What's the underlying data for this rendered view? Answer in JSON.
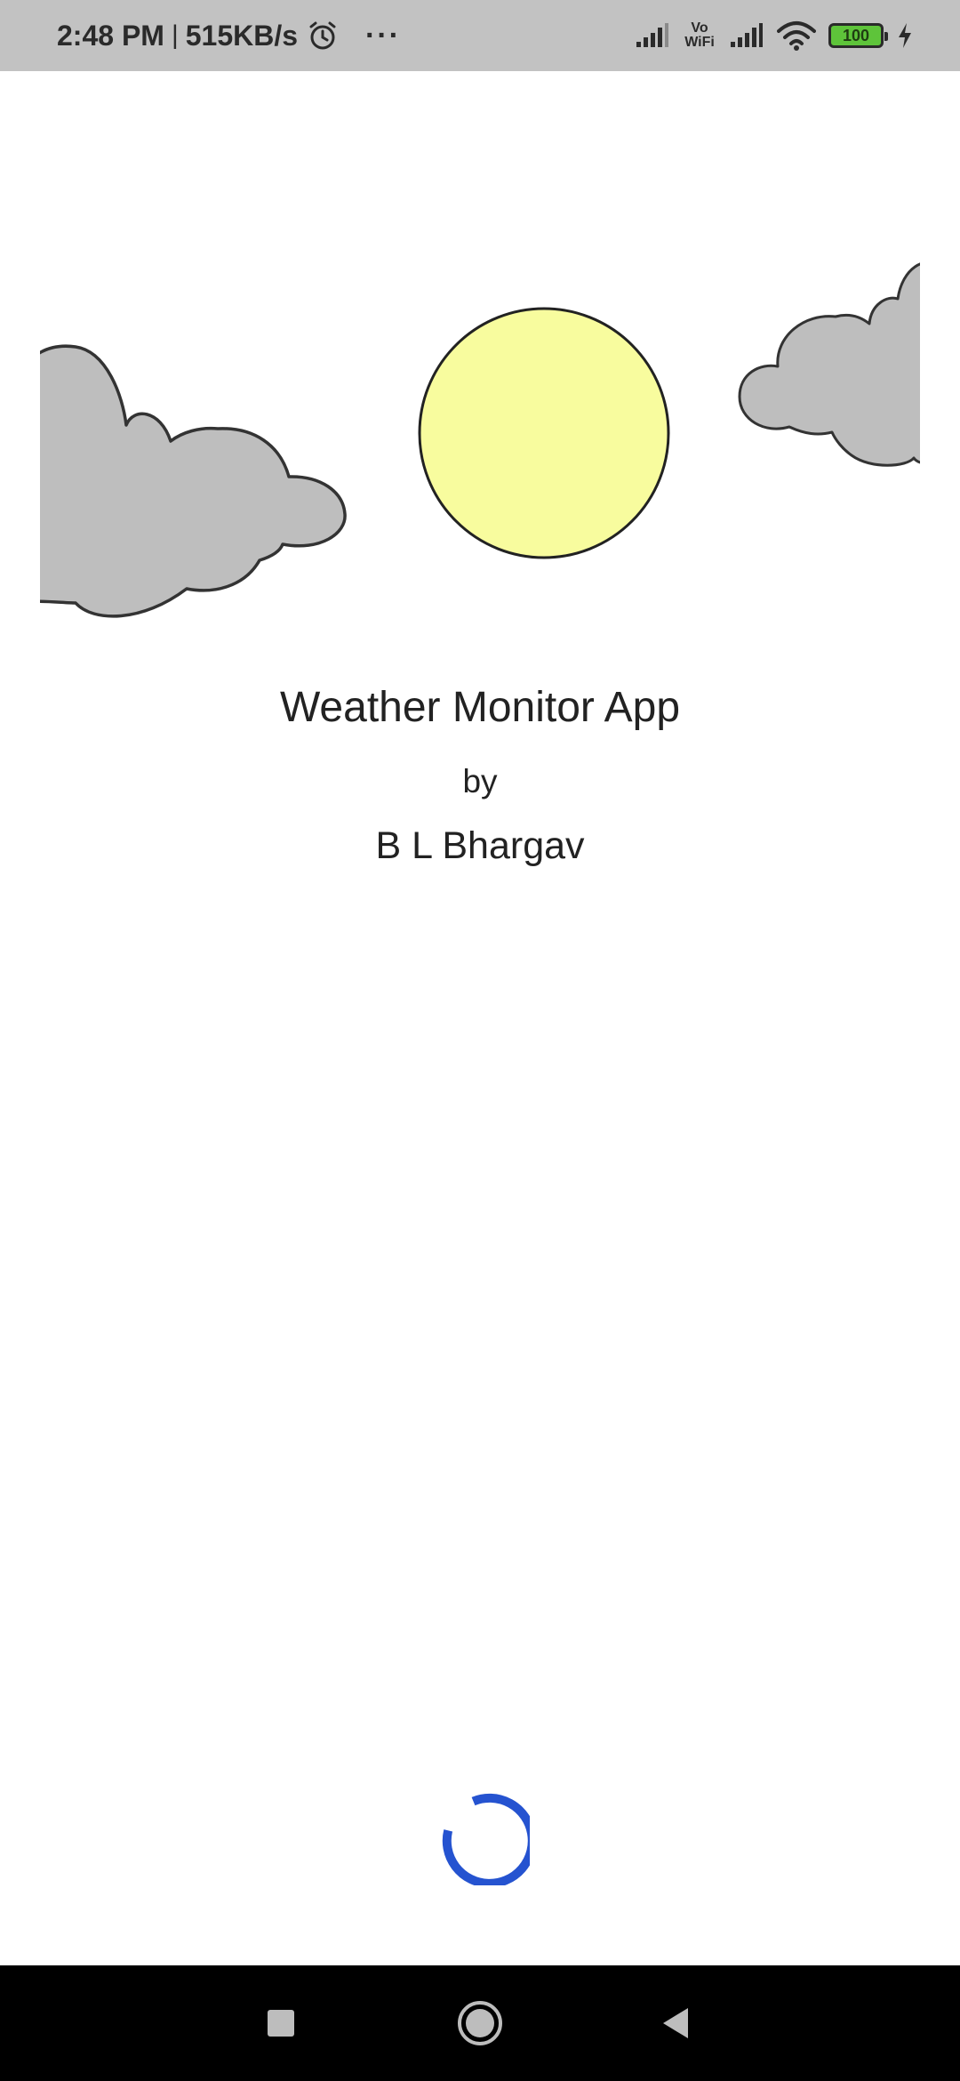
{
  "status_bar": {
    "time": "2:48 PM",
    "separator": "|",
    "speed": "515KB/s",
    "more": "···",
    "vowifi_top": "Vo",
    "vowifi_bottom": "WiFi",
    "battery_level": "100",
    "icons": [
      "alarm-icon",
      "signal-icon",
      "vowifi-icon",
      "signal-icon",
      "wifi-icon",
      "battery-icon",
      "charging-icon"
    ]
  },
  "illustration": {
    "elements": [
      "cloud-left",
      "sun",
      "cloud-right"
    ],
    "colors": {
      "sun": "#f8fc9e",
      "cloud": "#bebebe",
      "outline": "#333333"
    }
  },
  "splash": {
    "title": "Weather Monitor App",
    "by": "by",
    "author": "B L Bhargav"
  },
  "loader": {
    "color": "#2553d0"
  },
  "nav_bar": {
    "icons": [
      "recent-apps-icon",
      "home-icon",
      "back-icon"
    ]
  }
}
